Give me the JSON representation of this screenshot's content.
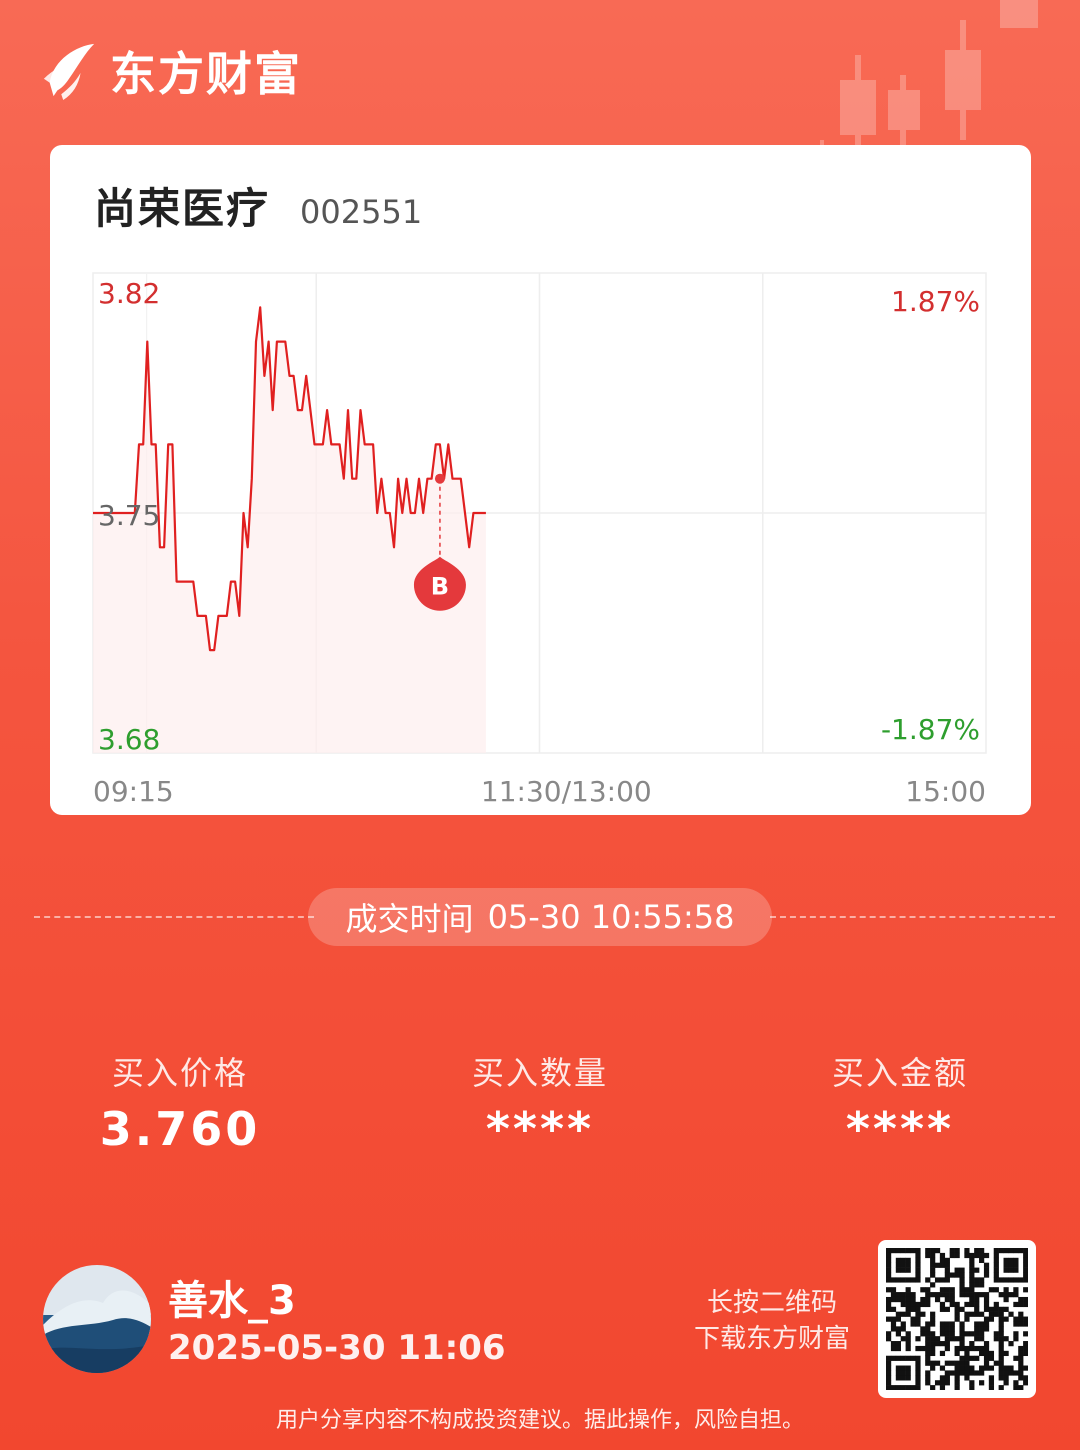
{
  "brand": {
    "name": "东方财富",
    "logo_icon": "feather-logo-icon"
  },
  "stock": {
    "name": "尚荣医疗",
    "code": "002551"
  },
  "chart_data": {
    "type": "line",
    "price_max_label": "3.82",
    "price_mid_label": "3.75",
    "price_min_label": "3.68",
    "pct_max_label": "1.87%",
    "pct_min_label": "-1.87%",
    "x_tick_labels": [
      "09:15",
      "11:30/13:00",
      "15:00"
    ],
    "ylim": [
      3.68,
      3.82
    ],
    "prev_close": 3.75,
    "series": [
      {
        "values": [
          3.75,
          3.75,
          3.75,
          3.75,
          3.75,
          3.75,
          3.75,
          3.75,
          3.75,
          3.75,
          3.75,
          3.77,
          3.77,
          3.8,
          3.77,
          3.77,
          3.74,
          3.74,
          3.77,
          3.77,
          3.73,
          3.73,
          3.73,
          3.73,
          3.73,
          3.72,
          3.72,
          3.72,
          3.71,
          3.71,
          3.72,
          3.72,
          3.72,
          3.73,
          3.73,
          3.72,
          3.75,
          3.74,
          3.76,
          3.8,
          3.81,
          3.79,
          3.8,
          3.78,
          3.8,
          3.8,
          3.8,
          3.79,
          3.79,
          3.78,
          3.78,
          3.79,
          3.78,
          3.77,
          3.77,
          3.77,
          3.78,
          3.77,
          3.77,
          3.77,
          3.76,
          3.78,
          3.76,
          3.76,
          3.78,
          3.77,
          3.77,
          3.77,
          3.75,
          3.76,
          3.75,
          3.75,
          3.74,
          3.76,
          3.75,
          3.76,
          3.75,
          3.75,
          3.76,
          3.75,
          3.76,
          3.76,
          3.77,
          3.77,
          3.76,
          3.77,
          3.76,
          3.76,
          3.76,
          3.75,
          3.74,
          3.75,
          3.75,
          3.75,
          3.75
        ],
        "color": "#e02020"
      }
    ],
    "trade_marker": {
      "label": "B",
      "index": 83,
      "price": 3.76,
      "color": "#e4393c"
    },
    "up_color": "#d32f2f",
    "down_color": "#2e9e2e",
    "grid": true
  },
  "trade": {
    "label": "成交时间",
    "time": "05-30 10:55:58"
  },
  "stats": [
    {
      "label": "买入价格",
      "value": "3.760"
    },
    {
      "label": "买入数量",
      "value": "****"
    },
    {
      "label": "买入金额",
      "value": "****"
    }
  ],
  "user": {
    "name": "善水_3",
    "time": "2025-05-30 11:06",
    "avatar_icon": "wave-avatar-icon"
  },
  "qr": {
    "hint_line1": "长按二维码",
    "hint_line2": "下载东方财富",
    "icon": "qr-code-icon"
  },
  "disclaimer": "用户分享内容不构成投资建议。据此操作，风险自担。"
}
